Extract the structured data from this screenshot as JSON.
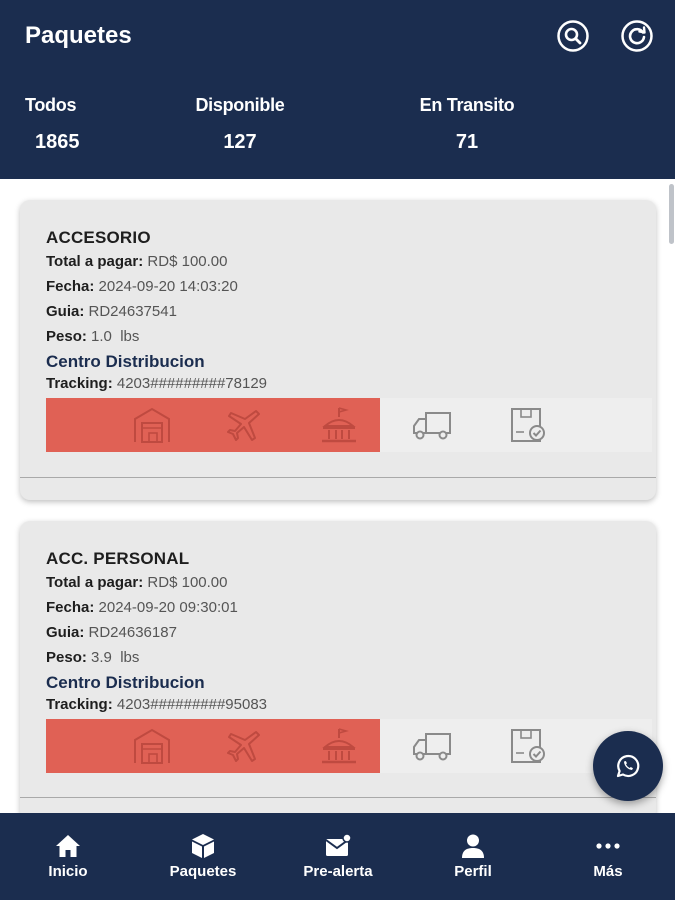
{
  "header": {
    "title": "Paquetes",
    "search_icon": "search-icon",
    "refresh_icon": "refresh-icon"
  },
  "stats": [
    {
      "label": "Todos",
      "value": "1865"
    },
    {
      "label": "Disponible",
      "value": "127"
    },
    {
      "label": "En Transito",
      "value": "71"
    }
  ],
  "labels": {
    "total": "Total a pagar:",
    "fecha": "Fecha:",
    "guia": "Guia:",
    "peso": "Peso:",
    "tracking": "Tracking:"
  },
  "packages": [
    {
      "title": "ACCESORIO",
      "total": "RD$ 100.00",
      "fecha": "2024-09-20 14:03:20",
      "guia": "RD24637541",
      "peso": "1.0  lbs",
      "center": "Centro Distribucion",
      "tracking": "4203#########78129",
      "progress_steps_completed": 3
    },
    {
      "title": "ACC. PERSONAL",
      "total": "RD$ 100.00",
      "fecha": "2024-09-20 09:30:01",
      "guia": "RD24636187",
      "peso": "3.9  lbs",
      "center": "Centro Distribucion",
      "tracking": "4203#########95083",
      "progress_steps_completed": 3
    }
  ],
  "progress_icons": [
    "warehouse-icon",
    "airplane-icon",
    "customs-building-icon",
    "delivery-truck-icon",
    "delivered-box-icon"
  ],
  "colors": {
    "primary": "#1b2d4f",
    "progress_fill": "#e06155",
    "card_bg": "#e9e9e9"
  },
  "nav": [
    {
      "label": "Inicio",
      "icon": "home-icon"
    },
    {
      "label": "Paquetes",
      "icon": "package-icon"
    },
    {
      "label": "Pre-alerta",
      "icon": "mail-alert-icon"
    },
    {
      "label": "Perfil",
      "icon": "person-icon"
    },
    {
      "label": "Más",
      "icon": "more-dots-icon"
    }
  ],
  "fab_icon": "whatsapp-icon"
}
